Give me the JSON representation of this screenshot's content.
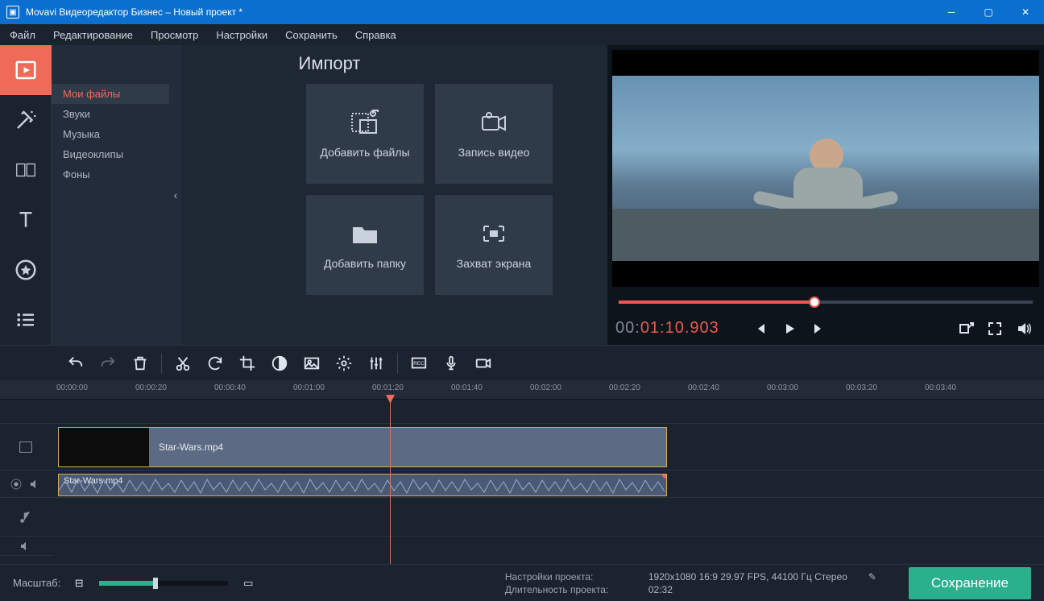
{
  "window": {
    "title": "Movavi Видеоредактор Бизнес – Новый проект *"
  },
  "menu": {
    "file": "Файл",
    "edit": "Редактирование",
    "view": "Просмотр",
    "settings": "Настройки",
    "save": "Сохранить",
    "help": "Справка"
  },
  "import": {
    "header": "Импорт",
    "list": {
      "my_files": "Мои файлы",
      "sounds": "Звуки",
      "music": "Музыка",
      "clips": "Видеоклипы",
      "bg": "Фоны"
    },
    "cards": {
      "add_files": "Добавить файлы",
      "rec_video": "Запись видео",
      "add_folder": "Добавить папку",
      "capture": "Захват экрана"
    }
  },
  "preview": {
    "timecode_gray": "00:",
    "timecode_red": "01:10.903"
  },
  "ruler": [
    "00:00:00",
    "00:00:20",
    "00:00:40",
    "00:01:00",
    "00:01:20",
    "00:01:40",
    "00:02:00",
    "00:02:20",
    "00:02:40",
    "00:03:00",
    "00:03:20",
    "00:03:40"
  ],
  "clips": {
    "video_name": "Star-Wars.mp4",
    "audio_name": "Star-Wars.mp4"
  },
  "status": {
    "zoom_label": "Масштаб:",
    "proj_settings_label": "Настройки проекта:",
    "proj_settings_value": "1920x1080 16:9 29.97 FPS, 44100 Гц Стерео",
    "proj_duration_label": "Длительность проекта:",
    "proj_duration_value": "02:32",
    "save_btn": "Сохранение"
  }
}
